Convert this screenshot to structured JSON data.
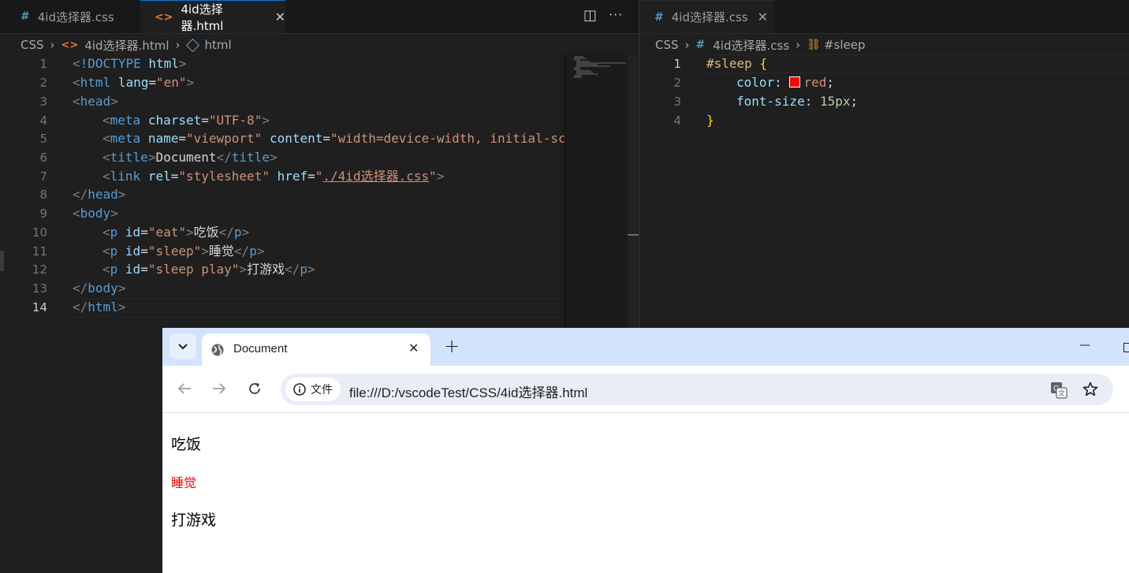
{
  "left_editor": {
    "tabs": [
      {
        "icon": "#",
        "label": "4id选择器.css"
      },
      {
        "icon": "<>",
        "label": "4id选择器.html",
        "close": "✕"
      }
    ],
    "actions": {
      "split": "◫",
      "more": "···"
    },
    "breadcrumb": [
      "CSS",
      "4id选择器.html",
      "html"
    ],
    "line_numbers": [
      "1",
      "2",
      "3",
      "4",
      "5",
      "6",
      "7",
      "8",
      "9",
      "10",
      "11",
      "12",
      "13",
      "14"
    ]
  },
  "right_editor": {
    "tab": {
      "icon": "#",
      "label": "4id选择器.css",
      "close": "✕"
    },
    "breadcrumb": [
      "CSS",
      "4id选择器.css",
      "#sleep"
    ],
    "line_numbers": [
      "1",
      "2",
      "3",
      "4"
    ]
  },
  "tokens": {
    "lt": "<",
    "gt": ">",
    "lt_slash": "</",
    "eq": "=",
    "doctype": "!DOCTYPE",
    "html": "html",
    "lang": "lang",
    "en": "\"en\"",
    "head": "head",
    "meta": "meta",
    "charset": "charset",
    "utf8": "\"UTF-8\"",
    "name": "name",
    "viewport": "\"viewport\"",
    "content": "content",
    "content_val": "\"width=device-width, initial-sca",
    "title": "title",
    "title_text": "Document",
    "link": "link",
    "rel": "rel",
    "stylesheet": "\"stylesheet\"",
    "href": "href",
    "quote": "\"",
    "href_val": "./4id选择器.css",
    "body": "body",
    "p": "p",
    "id": "id",
    "eat": "\"eat\"",
    "eat_text": "吃饭",
    "sleep": "\"sleep\"",
    "sleep_text": "睡觉",
    "sleep_play": "\"sleep play\"",
    "play_text": "打游戏",
    "css_selector": "#sleep",
    "open_brace": "{",
    "close_brace": "}",
    "color_prop": "color",
    "colon": ":",
    "red": "red",
    "semi": ";",
    "font_size_prop": "font-size",
    "px15": "15px"
  },
  "colors": {
    "swatch": "#ff0000",
    "page_red": "#ff0000"
  },
  "browser": {
    "tab_title": "Document",
    "tab_close": "✕",
    "new_tab": "+",
    "minimize": "—",
    "info_chip": "文件",
    "url": "file:///D:/vscodeTest/CSS/4id选择器.html",
    "page": [
      "吃饭",
      "睡觉",
      "打游戏"
    ]
  }
}
